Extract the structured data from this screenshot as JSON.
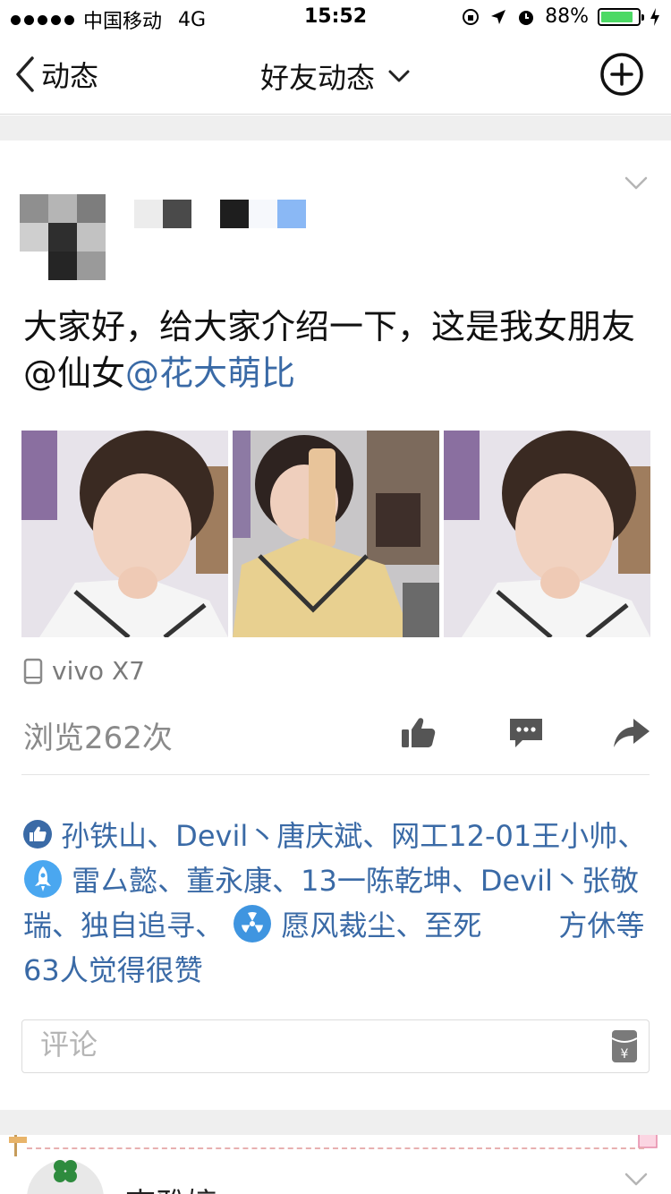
{
  "status_bar": {
    "carrier": "中国移动",
    "network": "4G",
    "time": "15:52",
    "battery": "88%",
    "battery_level": 0.88
  },
  "nav": {
    "back_label": "动态",
    "title": "好友动态"
  },
  "post": {
    "text": "大家好，给大家介绍一下，这是我女朋友@仙女",
    "mention": "@花大萌比",
    "device": "vivo X7",
    "views": "浏览262次",
    "likes": {
      "part1": "孙铁山、Devil丶唐庆斌、网工12-01王小帅、",
      "part2": "雷厶懿、董永康、13一陈乾坤、Devil丶张敬瑞、独自追寻、",
      "part3": "愿风裁尘、至死",
      "part4": "方休等63人觉得很赞"
    },
    "comment_placeholder": "评论"
  },
  "next_post": {
    "name_partial": "李雅婷"
  },
  "colors": {
    "link": "#3a6aa6",
    "battery": "#4cd964",
    "separator": "#efefef"
  }
}
